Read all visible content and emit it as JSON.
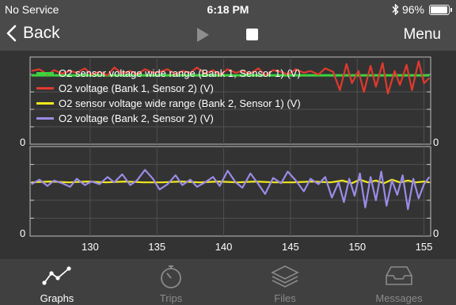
{
  "status_bar": {
    "carrier": "No Service",
    "time": "6:18 PM",
    "battery": "96%",
    "battery_level": 0.96
  },
  "nav": {
    "back_label": "Back",
    "menu_label": "Menu"
  },
  "colors": {
    "accent": "#ffffff",
    "bank1_wide": "#3dd23d",
    "bank1_s2": "#e03a2e",
    "bank2_wide": "#f0e81e",
    "bank2_s2": "#9b8be6",
    "tab_active": "#ffffff",
    "tab_inactive": "#8a8a8a"
  },
  "legend": [
    {
      "label": "O2 sensor voltage wide range (Bank 1, Sensor 1) (V)",
      "color": "#3dd23d"
    },
    {
      "label": "O2 voltage (Bank 1, Sensor 2) (V)",
      "color": "#e03a2e"
    },
    {
      "label": "O2 sensor voltage wide range (Bank 2, Sensor 1) (V)",
      "color": "#f0e81e"
    },
    {
      "label": "O2 voltage (Bank 2, Sensor 2) (V)",
      "color": "#9b8be6"
    }
  ],
  "y_labels": {
    "top_left": "0",
    "top_right": "0",
    "bottom_left": "0",
    "bottom_right": "0"
  },
  "chart_data": [
    {
      "type": "line",
      "panel": "top",
      "xlim": [
        125.5,
        155.5
      ],
      "xticks": [
        130,
        135,
        140,
        145,
        150,
        155
      ],
      "series": [
        {
          "name": "O2 sensor voltage wide range (Bank 1, Sensor 1) (V)",
          "color": "#3dd23d",
          "x": [
            125.6,
            155.4
          ],
          "y": [
            0.79,
            0.79
          ]
        },
        {
          "name": "O2 voltage (Bank 1, Sensor 2) (V)",
          "color": "#e03a2e",
          "x": [
            125.6,
            126.2,
            126.8,
            127.3,
            127.9,
            128.5,
            129.0,
            129.6,
            130.1,
            130.7,
            131.3,
            131.8,
            132.4,
            133.0,
            133.5,
            134.1,
            134.7,
            135.2,
            135.8,
            136.4,
            136.9,
            137.5,
            138.0,
            138.6,
            139.2,
            139.7,
            140.3,
            140.9,
            141.4,
            142.0,
            142.6,
            143.1,
            143.7,
            144.3,
            144.8,
            145.4,
            146.0,
            146.5,
            147.1,
            147.6,
            148.2,
            148.7,
            149.2,
            149.6,
            150.1,
            150.5,
            151.0,
            151.4,
            151.9,
            152.3,
            152.8,
            153.2,
            153.7,
            154.1,
            154.6,
            155.0,
            155.4
          ],
          "y": [
            0.84,
            0.86,
            0.8,
            0.85,
            0.81,
            0.84,
            0.82,
            0.87,
            0.8,
            0.83,
            0.79,
            0.88,
            0.81,
            0.84,
            0.8,
            0.86,
            0.82,
            0.83,
            0.86,
            0.8,
            0.84,
            0.82,
            0.88,
            0.81,
            0.85,
            0.8,
            0.86,
            0.82,
            0.84,
            0.81,
            0.87,
            0.79,
            0.85,
            0.83,
            0.8,
            0.86,
            0.82,
            0.84,
            0.8,
            0.87,
            0.83,
            0.62,
            0.92,
            0.7,
            0.84,
            0.6,
            0.9,
            0.66,
            0.93,
            0.58,
            0.84,
            0.68,
            0.91,
            0.62,
            0.95,
            0.7,
            0.76
          ]
        }
      ]
    },
    {
      "type": "line",
      "panel": "bottom",
      "xlim": [
        125.5,
        155.5
      ],
      "xticks": [
        130,
        135,
        140,
        145,
        150,
        155
      ],
      "series": [
        {
          "name": "O2 sensor voltage wide range (Bank 2, Sensor 1) (V)",
          "color": "#f0e81e",
          "x": [
            125.6,
            127.0,
            128.4,
            129.8,
            131.2,
            132.6,
            134.0,
            135.4,
            136.8,
            138.2,
            139.6,
            141.0,
            142.4,
            143.8,
            145.2,
            146.6,
            148.0,
            148.9,
            149.6,
            150.2,
            150.8,
            151.4,
            152.0,
            152.6,
            153.2,
            153.8,
            154.4,
            155.0,
            155.4
          ],
          "y": [
            0.6,
            0.61,
            0.6,
            0.61,
            0.6,
            0.61,
            0.6,
            0.6,
            0.61,
            0.6,
            0.61,
            0.6,
            0.61,
            0.6,
            0.6,
            0.61,
            0.6,
            0.62,
            0.59,
            0.63,
            0.6,
            0.62,
            0.59,
            0.63,
            0.6,
            0.62,
            0.6,
            0.61,
            0.6
          ]
        },
        {
          "name": "O2 voltage (Bank 2, Sensor 2) (V)",
          "color": "#9b8be6",
          "x": [
            125.6,
            126.2,
            126.8,
            127.3,
            127.9,
            128.5,
            129.0,
            129.6,
            130.1,
            130.7,
            131.3,
            131.8,
            132.4,
            133.0,
            133.5,
            134.1,
            134.7,
            135.2,
            135.8,
            136.4,
            136.9,
            137.5,
            138.0,
            138.6,
            139.2,
            139.7,
            140.3,
            140.9,
            141.4,
            142.0,
            142.6,
            143.1,
            143.7,
            144.3,
            144.8,
            145.4,
            146.0,
            146.5,
            147.1,
            147.6,
            148.1,
            148.6,
            149.0,
            149.4,
            149.8,
            150.2,
            150.6,
            151.0,
            151.4,
            151.8,
            152.2,
            152.6,
            153.0,
            153.4,
            153.8,
            154.2,
            154.6,
            155.0,
            155.4
          ],
          "y": [
            0.58,
            0.63,
            0.56,
            0.62,
            0.59,
            0.55,
            0.64,
            0.57,
            0.61,
            0.58,
            0.66,
            0.6,
            0.69,
            0.57,
            0.62,
            0.74,
            0.64,
            0.52,
            0.58,
            0.68,
            0.57,
            0.63,
            0.55,
            0.6,
            0.66,
            0.56,
            0.73,
            0.6,
            0.54,
            0.7,
            0.58,
            0.47,
            0.65,
            0.59,
            0.72,
            0.62,
            0.5,
            0.64,
            0.58,
            0.66,
            0.43,
            0.6,
            0.38,
            0.64,
            0.45,
            0.7,
            0.32,
            0.66,
            0.4,
            0.72,
            0.34,
            0.62,
            0.46,
            0.68,
            0.3,
            0.64,
            0.42,
            0.58,
            0.66
          ]
        }
      ]
    }
  ],
  "tabs": [
    {
      "label": "Graphs",
      "icon": "graphs-icon",
      "active": true
    },
    {
      "label": "Trips",
      "icon": "stopwatch-icon",
      "active": false
    },
    {
      "label": "Files",
      "icon": "layers-icon",
      "active": false
    },
    {
      "label": "Messages",
      "icon": "inbox-icon",
      "active": false
    }
  ]
}
